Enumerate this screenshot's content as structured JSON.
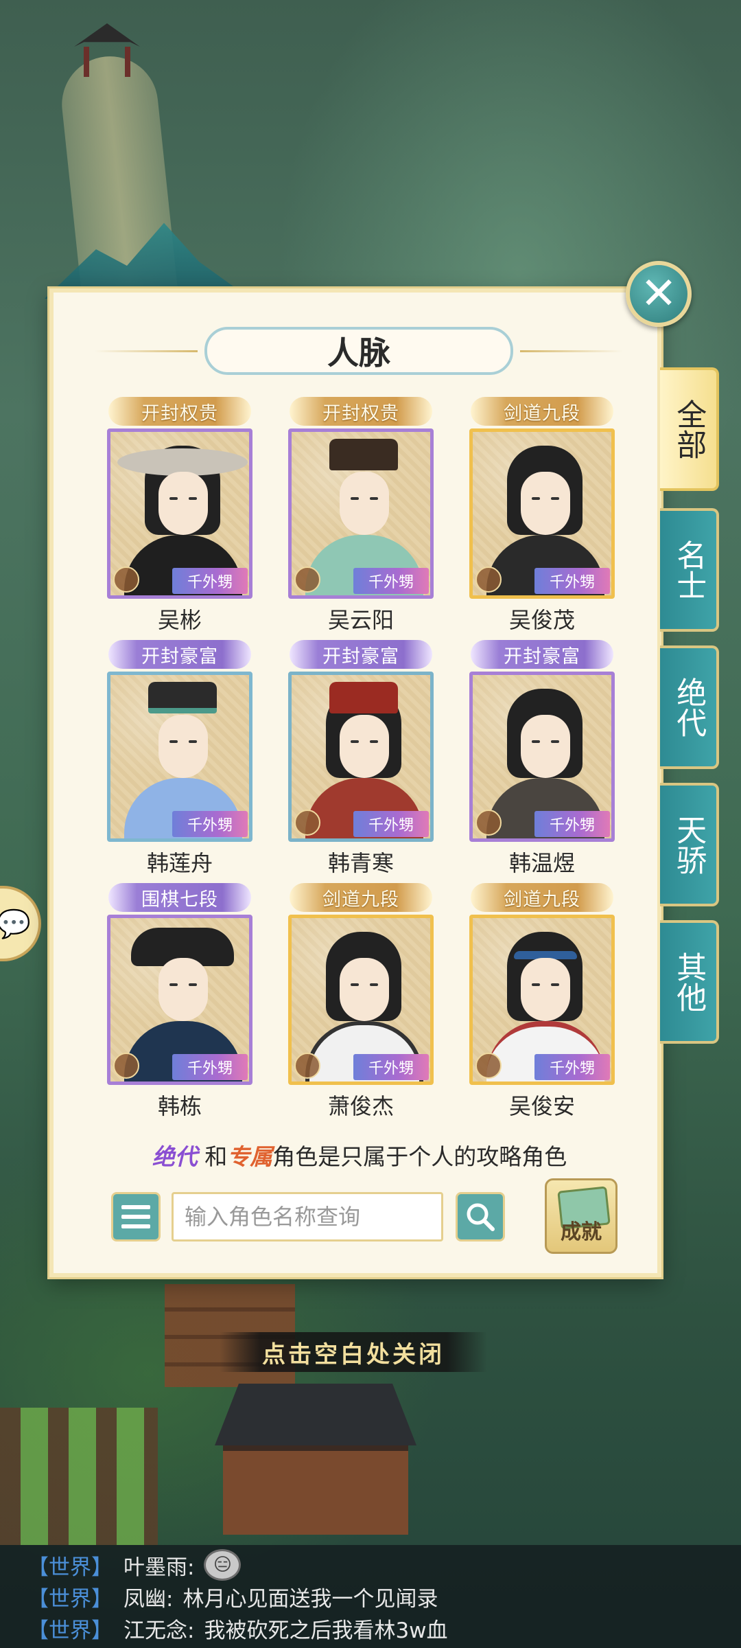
{
  "panel": {
    "title": "人脉",
    "close_icon": "close-icon"
  },
  "tabs": [
    {
      "label": "全部",
      "active": true
    },
    {
      "label": "名士",
      "active": false
    },
    {
      "label": "绝代",
      "active": false
    },
    {
      "label": "天骄",
      "active": false
    },
    {
      "label": "其他",
      "active": false
    }
  ],
  "characters": [
    {
      "tag": "开封权贵",
      "name": "吴彬",
      "badge": "千外甥"
    },
    {
      "tag": "开封权贵",
      "name": "吴云阳",
      "badge": "千外甥"
    },
    {
      "tag": "剑道九段",
      "name": "吴俊茂",
      "badge": "千外甥"
    },
    {
      "tag": "开封豪富",
      "name": "韩莲舟",
      "badge": "千外甥"
    },
    {
      "tag": "开封豪富",
      "name": "韩青寒",
      "badge": "千外甥"
    },
    {
      "tag": "开封豪富",
      "name": "韩温煜",
      "badge": "千外甥"
    },
    {
      "tag": "围棋七段",
      "name": "韩栋",
      "badge": "千外甥"
    },
    {
      "tag": "剑道九段",
      "name": "萧俊杰",
      "badge": "千外甥"
    },
    {
      "tag": "剑道九段",
      "name": "吴俊安",
      "badge": "千外甥"
    }
  ],
  "note": {
    "term1": "绝代",
    "connector": "和",
    "term2": "专属",
    "rest": "角色是只属于个人的攻略角色"
  },
  "search": {
    "placeholder": "输入角色名称查询"
  },
  "achievement_label": "成就",
  "close_hint": "点击空白处关闭",
  "chat": [
    {
      "channel": "【世界】",
      "sender": "叶墨雨:",
      "message": ""
    },
    {
      "channel": "【世界】",
      "sender": "凤幽:",
      "message": "林月心见面送我一个见闻录"
    },
    {
      "channel": "【世界】",
      "sender": "江无念:",
      "message": "我被砍死之后我看林3w血"
    }
  ]
}
